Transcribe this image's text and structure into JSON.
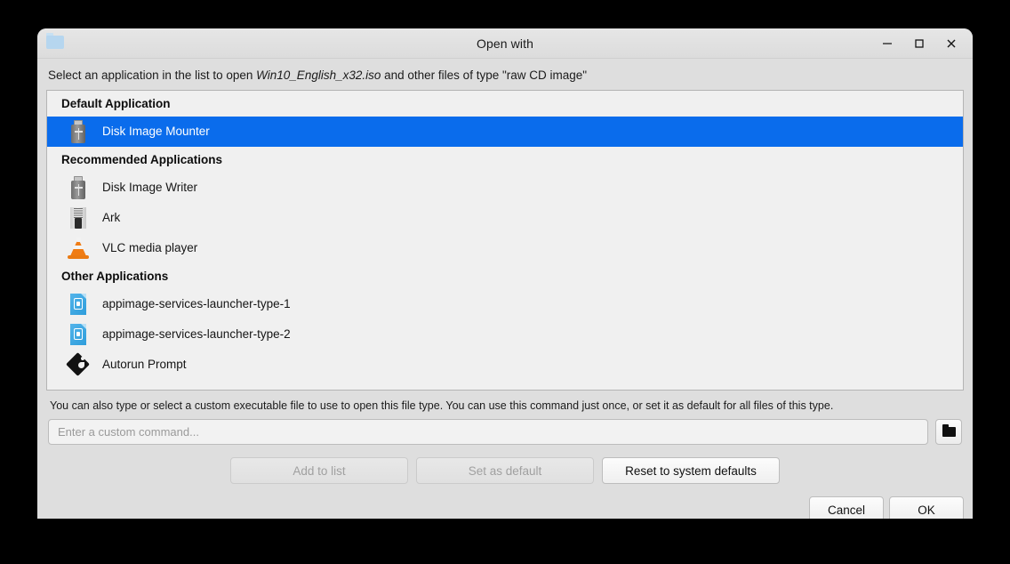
{
  "window": {
    "title": "Open with",
    "icon": "folder-icon",
    "controls": {
      "minimize": "−",
      "maximize": "□",
      "close": "×"
    }
  },
  "intro": {
    "prefix": "Select an application in the list to open ",
    "filename": "Win10_English_x32.iso",
    "suffix": " and other files of type \"raw CD image\""
  },
  "list": {
    "groups": [
      {
        "header": "Default Application",
        "items": [
          {
            "label": "Disk Image Mounter",
            "icon": "usb-drive-icon",
            "selected": true
          }
        ]
      },
      {
        "header": "Recommended Applications",
        "items": [
          {
            "label": "Disk Image Writer",
            "icon": "usb-drive-icon",
            "selected": false
          },
          {
            "label": "Ark",
            "icon": "zipper-archive-icon",
            "selected": false
          },
          {
            "label": "VLC media player",
            "icon": "vlc-cone-icon",
            "selected": false
          }
        ]
      },
      {
        "header": "Other Applications",
        "items": [
          {
            "label": "appimage-services-launcher-type-1",
            "icon": "appimage-document-icon",
            "selected": false
          },
          {
            "label": "appimage-services-launcher-type-2",
            "icon": "appimage-document-icon",
            "selected": false
          },
          {
            "label": "Autorun Prompt",
            "icon": "autorun-diamond-icon",
            "selected": false
          }
        ]
      }
    ]
  },
  "hint": "You can also type or select a custom executable file to use to open this file type.  You can use this command just once, or set it as default for all files of this type.",
  "custom_command": {
    "value": "",
    "placeholder": "Enter a custom command...",
    "browse_icon": "folder-icon"
  },
  "actions": {
    "add_to_list": "Add to list",
    "set_as_default": "Set as default",
    "reset_defaults": "Reset to system defaults"
  },
  "footer": {
    "cancel": "Cancel",
    "ok": "OK"
  },
  "colors": {
    "selection": "#0a6cec",
    "window_bg": "#dedede",
    "list_bg": "#f0f0f0"
  }
}
